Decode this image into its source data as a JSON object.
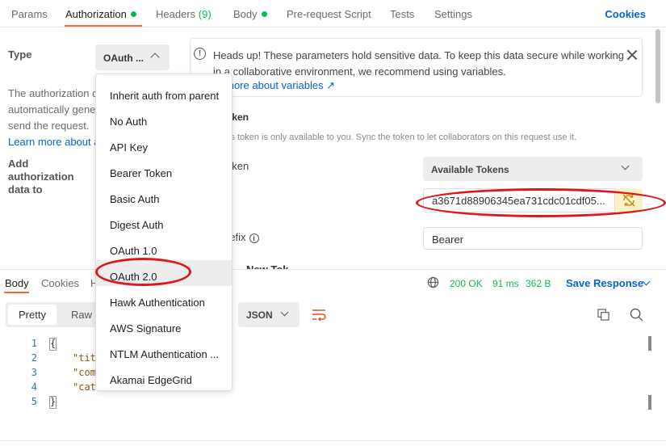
{
  "tabs": [
    {
      "label": "Params"
    },
    {
      "label": "Authorization"
    },
    {
      "label": "Headers",
      "count": "(9)"
    },
    {
      "label": "Body"
    },
    {
      "label": "Pre-request Script"
    },
    {
      "label": "Tests"
    },
    {
      "label": "Settings"
    }
  ],
  "cookies_label": "Cookies",
  "left": {
    "type_label": "Type",
    "type_value": "OAuth ...",
    "description": [
      "The authorization d",
      "automatically gene",
      "send the request."
    ],
    "learn_more": "Learn more about a",
    "add_label": "Add authorization data to"
  },
  "info": {
    "text": "Heads up! These parameters hold sensitive data. To keep this data secure while working in a collaborative environment, we recommend using variables.",
    "link": "rn more about variables ↗"
  },
  "token_section": {
    "title": "oken",
    "subtitle": "ss token is only available to you. Sync the token to let collaborators on this request use it.",
    "token_label": "oken",
    "available_tokens": "Available Tokens",
    "token_value": "a3671d88906345ea731cdc01cdf05...",
    "prefix_label": "refix",
    "prefix_value": "Bearer",
    "partial_title": "New Tok"
  },
  "response": {
    "tabs": [
      "Body",
      "Cookies",
      "H"
    ],
    "status": "200 OK",
    "time": "91 ms",
    "size": "362 B",
    "save_label": "Save Response",
    "view_pretty": "Pretty",
    "view_raw": "Raw",
    "format": "JSON"
  },
  "code": {
    "line_numbers": [
      "1",
      "2",
      "3",
      "4",
      "5"
    ],
    "lines": [
      "{",
      "\"tit",
      "\"com",
      "\"cat",
      "}"
    ]
  },
  "menu": {
    "items": [
      "Inherit auth from parent",
      "No Auth",
      "API Key",
      "Bearer Token",
      "Basic Auth",
      "Digest Auth",
      "OAuth 1.0",
      "OAuth 2.0",
      "Hawk Authentication",
      "AWS Signature",
      "NTLM Authentication ...",
      "Akamai EdgeGrid"
    ],
    "selected": "OAuth 2.0"
  },
  "colors": {
    "accent": "#f26b3a",
    "link": "#0265d2",
    "success": "#0cbb52",
    "annotation": "#e0161c"
  }
}
